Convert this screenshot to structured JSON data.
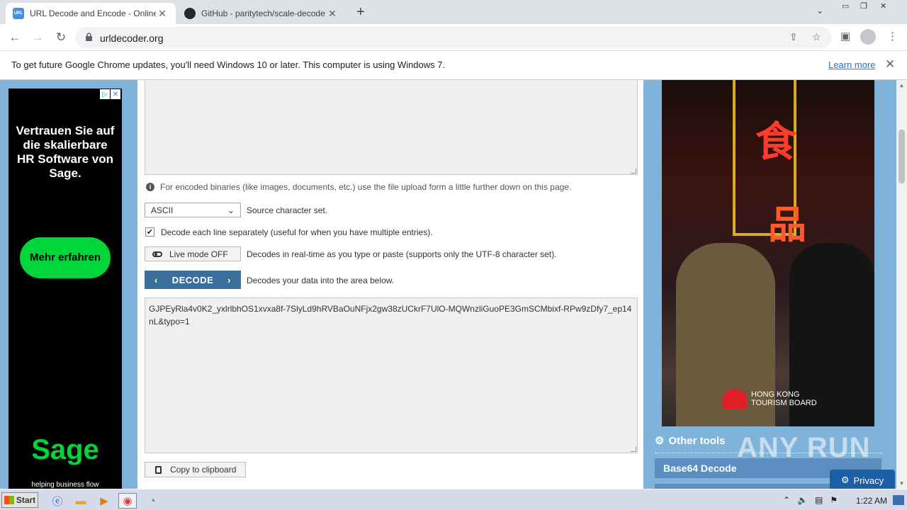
{
  "browser": {
    "tabs": [
      {
        "title": "URL Decode and Encode - Online",
        "favicon": "URL",
        "favicon_color": "#4a90d9"
      },
      {
        "title": "GitHub - paritytech/scale-decode: De",
        "favicon": "github-icon",
        "favicon_color": "#24292e"
      }
    ],
    "new_tab_symbol": "+",
    "url": "urldecoder.org"
  },
  "infobar": {
    "message": "To get future Google Chrome updates, you'll need Windows 10 or later. This computer is using Windows 7.",
    "learn_more": "Learn more"
  },
  "ad_left": {
    "headline": "Vertrauen Sie auf die skalierbare HR Software von Sage.",
    "cta": "Mehr erfahren",
    "brand": "Sage",
    "tagline": "helping business flow",
    "brand_color": "#00d639"
  },
  "form": {
    "hint": "For encoded binaries (like images, documents, etc.) use the file upload form a little further down on this page.",
    "charset_value": "ASCII",
    "charset_label": "Source character set.",
    "decode_each_line_label": "Decode each line separately (useful for when you have multiple entries).",
    "decode_each_line_checked": true,
    "live_mode_label": "Live mode OFF",
    "live_mode_desc": "Decodes in real-time as you type or paste (supports only the UTF-8 character set).",
    "decode_label": "DECODE",
    "decode_desc": "Decodes your data into the area below.",
    "output": "GJPEyRla4v0K2_yxlrlbhOS1xvxa8f-7SlyLd9hRVBaOuNFjx2gw38zUCkrF7UlO-MQWnzliGuoPE3GmSCMbixf-RPw9zDfy7_ep14nL&typo=1",
    "copy_label": "Copy to clipboard",
    "accent_color": "#3a6f9c"
  },
  "ad_right": {
    "sponsor_line1": "HONG KONG",
    "sponsor_line2": "TOURISM BOARD"
  },
  "sidebar": {
    "tools_title": "Other tools",
    "items": [
      "Base64 Decode"
    ]
  },
  "overlay": {
    "watermark": "ANY RUN",
    "privacy": "Privacy"
  },
  "taskbar": {
    "start": "Start",
    "clock": "1:22 AM"
  }
}
